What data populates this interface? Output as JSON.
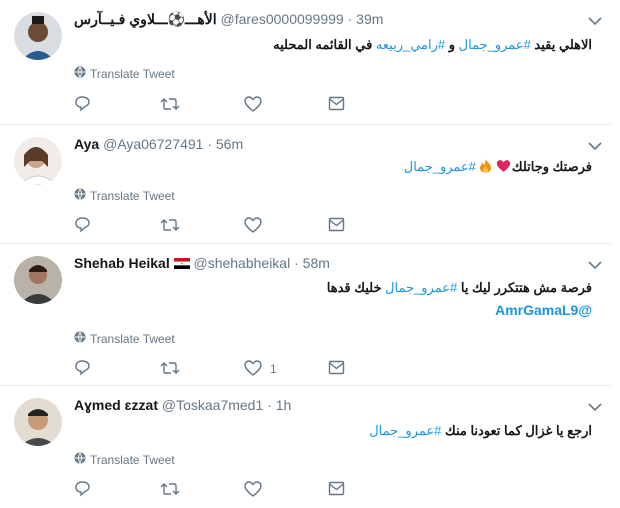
{
  "colors": {
    "link": "#1b95e0",
    "muted": "#657786",
    "heart": "#e0245e",
    "border": "#e6ecf0"
  },
  "common": {
    "translate_label": "Translate Tweet"
  },
  "tweets": [
    {
      "name": "الأهـــ⚽ـــلاوي فـيــآرس",
      "handle": "@fares0000099999",
      "sep": "·",
      "time": "39m",
      "text": "الاهلي يقيد ",
      "hashtag1": "#عمرو_جمال",
      "text_mid": " و ",
      "hashtag2": "#رامي_ربيعه",
      "text_end": " في القائمه المحليه",
      "like_count": ""
    },
    {
      "name": "Aya",
      "handle": "@Aya06727491",
      "sep": "·",
      "time": "56m",
      "text": "فرصتك وجاتلك",
      "hashtag1": "#عمرو_جمال",
      "like_count": ""
    },
    {
      "name": "Shehab Heikal",
      "handle": "@shehabheikal",
      "sep": "·",
      "time": "58m",
      "text": "فرصة مش هتتكرر ليك يا ",
      "hashtag1": "#عمرو_جمال",
      "text_end": " خليك قدها",
      "mention": "@AmrGamaL9",
      "like_count": "1"
    },
    {
      "name": "Aɣmed ɛzzat",
      "handle": "@Toskaa7med1",
      "sep": "·",
      "time": "1h",
      "text": "ارجع يا غزال كما تعودنا منك ",
      "hashtag1": "#عمرو_جمال",
      "like_count": ""
    }
  ]
}
